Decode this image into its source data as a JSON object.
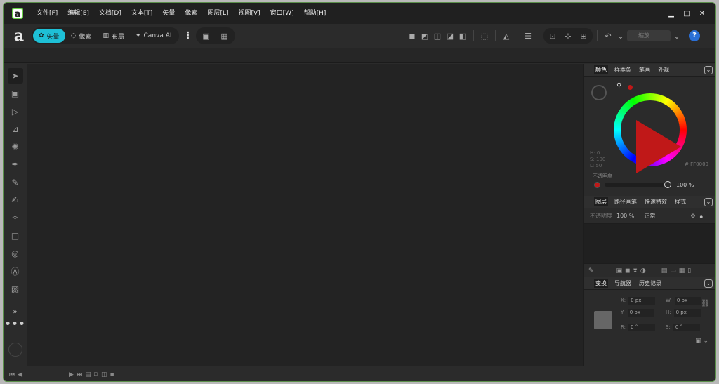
{
  "menubar": {
    "logo": "a",
    "items": [
      "文件[F]",
      "编辑[E]",
      "文档[D]",
      "文本[T]",
      "矢量",
      "像素",
      "图层[L]",
      "视图[V]",
      "窗口[W]",
      "帮助[H]"
    ],
    "minimize": "▁",
    "maximize": "□",
    "close": "✕"
  },
  "toolbar": {
    "logo": "a",
    "personas": [
      {
        "label": "矢量",
        "icon": "vector-persona-icon"
      },
      {
        "label": "像素",
        "icon": "pixel-persona-icon"
      },
      {
        "label": "布局",
        "icon": "layout-persona-icon"
      },
      {
        "label": "Canva AI",
        "icon": "sparkle-icon"
      }
    ],
    "active_persona": "矢量",
    "more": "⋮",
    "dropdown_value": "缩放",
    "help": "?"
  },
  "panels": {
    "color": {
      "tabs": [
        "颜色",
        "样本条",
        "笔画",
        "外观"
      ],
      "active_tab": "颜色",
      "hsl": [
        "H: 0",
        "S: 100",
        "L: 50"
      ],
      "hex": "FF0000",
      "opacity_label": "不透明度",
      "opacity_value": "100 %",
      "opacity_level": 1.0,
      "current_color": "#c01818"
    },
    "layers": {
      "tabs": [
        "图层",
        "路径画笔",
        "快速特效",
        "样式"
      ],
      "active_tab": "图层",
      "opacity_label": "不透明度",
      "opacity_value": "100 %",
      "blend_mode": "正常"
    },
    "transform": {
      "tabs": [
        "变换",
        "导航器",
        "历史记录"
      ],
      "active_tab": "变换",
      "x_label": "X:",
      "x_value": "0 px",
      "y_label": "Y:",
      "y_value": "0 px",
      "w_label": "W:",
      "w_value": "0 px",
      "h_label": "H:",
      "h_value": "0 px",
      "r_label": "R:",
      "r_value": "0 °",
      "s_label": "S:",
      "s_value": "0 °"
    }
  },
  "tools": [
    "move-tool-icon",
    "artboard-tool-icon",
    "node-tool-icon",
    "corner-tool-icon",
    "knife-tool-icon",
    "pen-tool-icon",
    "pencil-tool-icon",
    "brush-tool-icon",
    "fill-tool-icon",
    "rectangle-tool-icon",
    "shape-tool-icon",
    "text-tool-icon",
    "image-tool-icon"
  ],
  "tools_more": "»",
  "tools_ellipsis": "•••",
  "accent": "#1ec0d6"
}
